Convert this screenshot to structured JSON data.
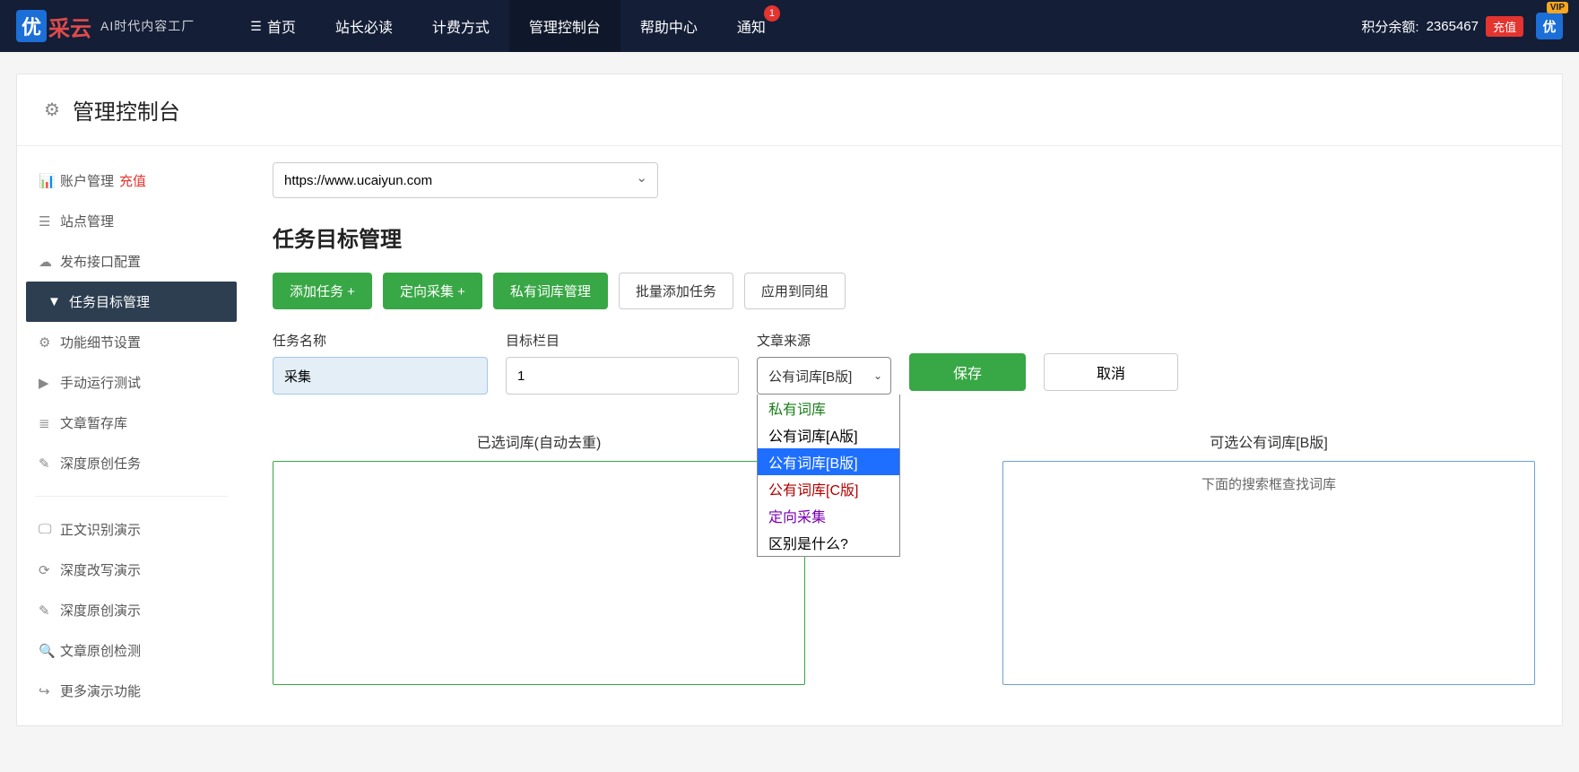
{
  "logo": {
    "badge": "优",
    "name": "采云",
    "tagline": "AI时代内容工厂"
  },
  "nav": {
    "items": [
      {
        "label": "首页",
        "icon": true,
        "active": false
      },
      {
        "label": "站长必读",
        "active": false
      },
      {
        "label": "计费方式",
        "active": false
      },
      {
        "label": "管理控制台",
        "active": true
      },
      {
        "label": "帮助中心",
        "active": false
      },
      {
        "label": "通知",
        "active": false,
        "badge": "1"
      }
    ],
    "points_label": "积分余额:",
    "points_value": "2365467",
    "recharge": "充值",
    "avatar": "优",
    "vip": "VIP"
  },
  "header": {
    "title": "管理控制台"
  },
  "sidebar": {
    "main": [
      {
        "label": "账户管理",
        "icon": "bars",
        "suffix": "充值"
      },
      {
        "label": "站点管理",
        "icon": "list"
      },
      {
        "label": "发布接口配置",
        "icon": "cloud"
      },
      {
        "label": "任务目标管理",
        "icon": "filter",
        "active": true
      },
      {
        "label": "功能细节设置",
        "icon": "cogs"
      },
      {
        "label": "手动运行测试",
        "icon": "play"
      },
      {
        "label": "文章暂存库",
        "icon": "db"
      },
      {
        "label": "深度原创任务",
        "icon": "edit"
      }
    ],
    "demo": [
      {
        "label": "正文识别演示",
        "icon": "monitor"
      },
      {
        "label": "深度改写演示",
        "icon": "refresh"
      },
      {
        "label": "深度原创演示",
        "icon": "edit"
      },
      {
        "label": "文章原创检测",
        "icon": "search"
      },
      {
        "label": "更多演示功能",
        "icon": "share"
      }
    ]
  },
  "main": {
    "site_selected": "https://www.ucaiyun.com",
    "title": "任务目标管理",
    "buttons": {
      "add_task": "添加任务 +",
      "targeted": "定向采集 +",
      "private_lib": "私有词库管理",
      "batch": "批量添加任务",
      "apply_group": "应用到同组"
    },
    "form": {
      "task_name_label": "任务名称",
      "task_name_value": "采集",
      "target_col_label": "目标栏目",
      "target_col_value": "1",
      "source_label": "文章来源",
      "source_selected": "公有词库[B版]",
      "options": {
        "private": "私有词库",
        "public_a": "公有词库[A版]",
        "public_b": "公有词库[B版]",
        "public_c": "公有词库[C版]",
        "targeted": "定向采集",
        "diff": "区别是什么?"
      },
      "save": "保存",
      "cancel": "取消"
    },
    "panels": {
      "left_title": "已选词库(自动去重)",
      "right_title": "可选公有词库[B版]",
      "right_note": "下面的搜索框查找词库"
    }
  }
}
